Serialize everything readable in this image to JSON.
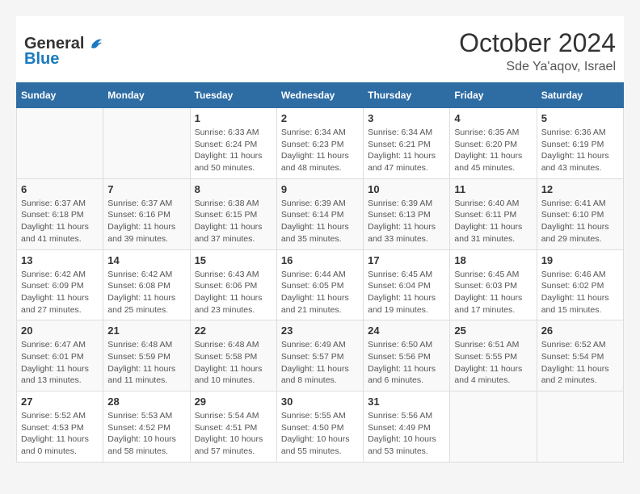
{
  "header": {
    "logo_general": "General",
    "logo_blue": "Blue",
    "month_title": "October 2024",
    "location": "Sde Ya'aqov, Israel"
  },
  "days_of_week": [
    "Sunday",
    "Monday",
    "Tuesday",
    "Wednesday",
    "Thursday",
    "Friday",
    "Saturday"
  ],
  "weeks": [
    {
      "days": [
        {
          "num": "",
          "info": ""
        },
        {
          "num": "",
          "info": ""
        },
        {
          "num": "1",
          "info": "Sunrise: 6:33 AM\nSunset: 6:24 PM\nDaylight: 11 hours and 50 minutes."
        },
        {
          "num": "2",
          "info": "Sunrise: 6:34 AM\nSunset: 6:23 PM\nDaylight: 11 hours and 48 minutes."
        },
        {
          "num": "3",
          "info": "Sunrise: 6:34 AM\nSunset: 6:21 PM\nDaylight: 11 hours and 47 minutes."
        },
        {
          "num": "4",
          "info": "Sunrise: 6:35 AM\nSunset: 6:20 PM\nDaylight: 11 hours and 45 minutes."
        },
        {
          "num": "5",
          "info": "Sunrise: 6:36 AM\nSunset: 6:19 PM\nDaylight: 11 hours and 43 minutes."
        }
      ]
    },
    {
      "days": [
        {
          "num": "6",
          "info": "Sunrise: 6:37 AM\nSunset: 6:18 PM\nDaylight: 11 hours and 41 minutes."
        },
        {
          "num": "7",
          "info": "Sunrise: 6:37 AM\nSunset: 6:16 PM\nDaylight: 11 hours and 39 minutes."
        },
        {
          "num": "8",
          "info": "Sunrise: 6:38 AM\nSunset: 6:15 PM\nDaylight: 11 hours and 37 minutes."
        },
        {
          "num": "9",
          "info": "Sunrise: 6:39 AM\nSunset: 6:14 PM\nDaylight: 11 hours and 35 minutes."
        },
        {
          "num": "10",
          "info": "Sunrise: 6:39 AM\nSunset: 6:13 PM\nDaylight: 11 hours and 33 minutes."
        },
        {
          "num": "11",
          "info": "Sunrise: 6:40 AM\nSunset: 6:11 PM\nDaylight: 11 hours and 31 minutes."
        },
        {
          "num": "12",
          "info": "Sunrise: 6:41 AM\nSunset: 6:10 PM\nDaylight: 11 hours and 29 minutes."
        }
      ]
    },
    {
      "days": [
        {
          "num": "13",
          "info": "Sunrise: 6:42 AM\nSunset: 6:09 PM\nDaylight: 11 hours and 27 minutes."
        },
        {
          "num": "14",
          "info": "Sunrise: 6:42 AM\nSunset: 6:08 PM\nDaylight: 11 hours and 25 minutes."
        },
        {
          "num": "15",
          "info": "Sunrise: 6:43 AM\nSunset: 6:06 PM\nDaylight: 11 hours and 23 minutes."
        },
        {
          "num": "16",
          "info": "Sunrise: 6:44 AM\nSunset: 6:05 PM\nDaylight: 11 hours and 21 minutes."
        },
        {
          "num": "17",
          "info": "Sunrise: 6:45 AM\nSunset: 6:04 PM\nDaylight: 11 hours and 19 minutes."
        },
        {
          "num": "18",
          "info": "Sunrise: 6:45 AM\nSunset: 6:03 PM\nDaylight: 11 hours and 17 minutes."
        },
        {
          "num": "19",
          "info": "Sunrise: 6:46 AM\nSunset: 6:02 PM\nDaylight: 11 hours and 15 minutes."
        }
      ]
    },
    {
      "days": [
        {
          "num": "20",
          "info": "Sunrise: 6:47 AM\nSunset: 6:01 PM\nDaylight: 11 hours and 13 minutes."
        },
        {
          "num": "21",
          "info": "Sunrise: 6:48 AM\nSunset: 5:59 PM\nDaylight: 11 hours and 11 minutes."
        },
        {
          "num": "22",
          "info": "Sunrise: 6:48 AM\nSunset: 5:58 PM\nDaylight: 11 hours and 10 minutes."
        },
        {
          "num": "23",
          "info": "Sunrise: 6:49 AM\nSunset: 5:57 PM\nDaylight: 11 hours and 8 minutes."
        },
        {
          "num": "24",
          "info": "Sunrise: 6:50 AM\nSunset: 5:56 PM\nDaylight: 11 hours and 6 minutes."
        },
        {
          "num": "25",
          "info": "Sunrise: 6:51 AM\nSunset: 5:55 PM\nDaylight: 11 hours and 4 minutes."
        },
        {
          "num": "26",
          "info": "Sunrise: 6:52 AM\nSunset: 5:54 PM\nDaylight: 11 hours and 2 minutes."
        }
      ]
    },
    {
      "days": [
        {
          "num": "27",
          "info": "Sunrise: 5:52 AM\nSunset: 4:53 PM\nDaylight: 11 hours and 0 minutes."
        },
        {
          "num": "28",
          "info": "Sunrise: 5:53 AM\nSunset: 4:52 PM\nDaylight: 10 hours and 58 minutes."
        },
        {
          "num": "29",
          "info": "Sunrise: 5:54 AM\nSunset: 4:51 PM\nDaylight: 10 hours and 57 minutes."
        },
        {
          "num": "30",
          "info": "Sunrise: 5:55 AM\nSunset: 4:50 PM\nDaylight: 10 hours and 55 minutes."
        },
        {
          "num": "31",
          "info": "Sunrise: 5:56 AM\nSunset: 4:49 PM\nDaylight: 10 hours and 53 minutes."
        },
        {
          "num": "",
          "info": ""
        },
        {
          "num": "",
          "info": ""
        }
      ]
    }
  ]
}
